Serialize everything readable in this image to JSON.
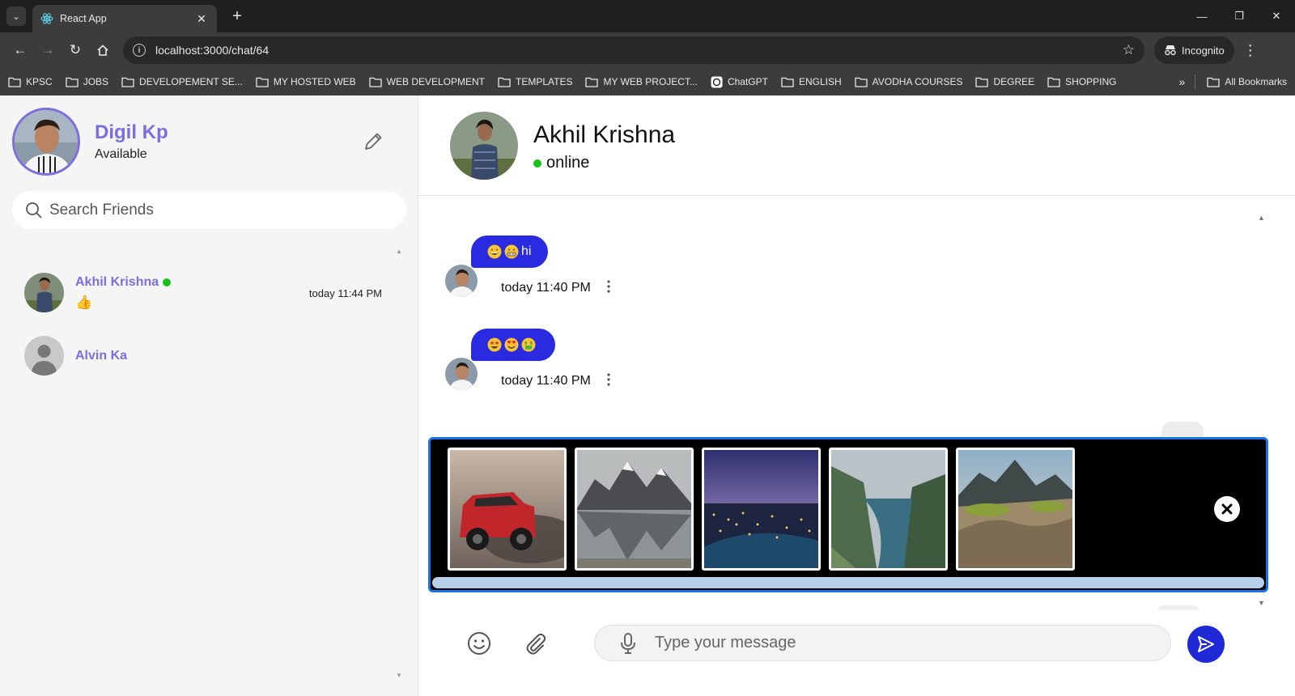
{
  "browser": {
    "tab_title": "React App",
    "url": "localhost:3000/chat/64",
    "incognito_label": "Incognito",
    "bookmarks": [
      "KPSC",
      "JOBS",
      "DEVELOPEMENT SE...",
      "MY HOSTED WEB",
      "WEB DEVELOPMENT",
      "TEMPLATES",
      "MY WEB PROJECT...",
      "ChatGPT",
      "ENGLISH",
      "AVODHA COURSES",
      "DEGREE",
      "SHOPPING"
    ],
    "all_bookmarks_label": "All Bookmarks"
  },
  "sidebar": {
    "profile": {
      "name": "Digil Kp",
      "status": "Available"
    },
    "search_placeholder": "Search Friends",
    "friends": [
      {
        "name": "Akhil Krishna",
        "online": true,
        "last_message": "👍",
        "time": "today 11:44 PM"
      },
      {
        "name": "Alvin Ka",
        "online": false,
        "last_message": "",
        "time": ""
      }
    ]
  },
  "chat": {
    "contact_name": "Akhil Krishna",
    "contact_status": "online",
    "messages": [
      {
        "text": "hi",
        "emojis": [
          "grin",
          "grimace"
        ],
        "time": "today 11:40 PM"
      },
      {
        "text": "",
        "emojis": [
          "star-eyes",
          "heart-eyes",
          "money-mouth"
        ],
        "time": "today 11:40 PM"
      }
    ],
    "preview_images": [
      "red-suv",
      "mountain-lake",
      "city-night",
      "fjord",
      "sand-dunes"
    ],
    "input_placeholder": "Type your message"
  },
  "colors": {
    "accent": "#7b6fe0",
    "bubble": "#2a2be0",
    "send": "#2029d6",
    "online": "#19c219",
    "preview_border": "#1a73e8"
  }
}
